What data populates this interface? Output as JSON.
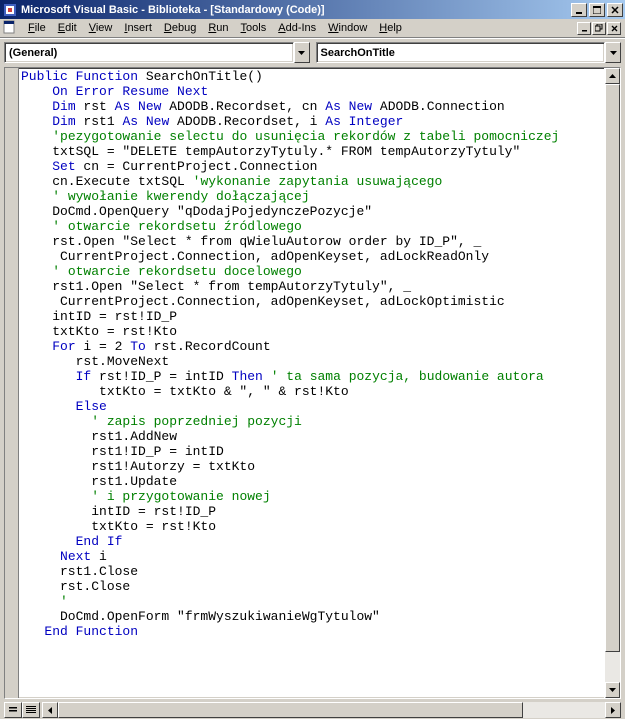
{
  "window": {
    "title": "Microsoft Visual Basic - Biblioteka - [Standardowy (Code)]"
  },
  "menu": {
    "file": "File",
    "edit": "Edit",
    "view": "View",
    "insert": "Insert",
    "debug": "Debug",
    "run": "Run",
    "tools": "Tools",
    "addins": "Add-Ins",
    "window": "Window",
    "help": "Help"
  },
  "dropdowns": {
    "object": "(General)",
    "procedure": "SearchOnTitle"
  },
  "code": {
    "l1a": "Public Function",
    "l1b": " SearchOnTitle()",
    "l2a": "    ",
    "l2b": "On Error Resume Next",
    "l3a": "    ",
    "l3b": "Dim",
    "l3c": " rst ",
    "l3d": "As New",
    "l3e": " ADODB.Recordset, cn ",
    "l3f": "As New",
    "l3g": " ADODB.Connection",
    "l4a": "    ",
    "l4b": "Dim",
    "l4c": " rst1 ",
    "l4d": "As New",
    "l4e": " ADODB.Recordset, i ",
    "l4f": "As Integer",
    "l5a": "    ",
    "l5b": "'pezygotowanie selectu do usunięcia rekordów z tabeli pomocniczej",
    "l6": "    txtSQL = \"DELETE tempAutorzyTytuly.* FROM tempAutorzyTytuly\"",
    "l7a": "    ",
    "l7b": "Set",
    "l7c": " cn = CurrentProject.Connection",
    "l8a": "    cn.Execute txtSQL ",
    "l8b": "'wykonanie zapytania usuwającego",
    "l9a": "    ",
    "l9b": "' wywołanie kwerendy dołączającej",
    "l10": "    DoCmd.OpenQuery \"qDodajPojedynczePozycje\"",
    "l11a": "    ",
    "l11b": "' otwarcie rekordsetu źródlowego",
    "l12": "    rst.Open \"Select * from qWieluAutorow order by ID_P\", _",
    "l13": "     CurrentProject.Connection, adOpenKeyset, adLockReadOnly",
    "l14a": "    ",
    "l14b": "' otwarcie rekordsetu docelowego",
    "l15": "    rst1.Open \"Select * from tempAutorzyTytuly\", _",
    "l16": "     CurrentProject.Connection, adOpenKeyset, adLockOptimistic",
    "l17": "    intID = rst!ID_P",
    "l18": "    txtKto = rst!Kto",
    "l19a": "    ",
    "l19b": "For",
    "l19c": " i = 2 ",
    "l19d": "To",
    "l19e": " rst.RecordCount",
    "l20": "       rst.MoveNext",
    "l21a": "       ",
    "l21b": "If",
    "l21c": " rst!ID_P = intID ",
    "l21d": "Then",
    "l21e": " ",
    "l21f": "' ta sama pozycja, budowanie autora",
    "l22": "          txtKto = txtKto & \", \" & rst!Kto",
    "l23a": "       ",
    "l23b": "Else",
    "l24a": "         ",
    "l24b": "' zapis poprzedniej pozycji",
    "l25": "         rst1.AddNew",
    "l26": "         rst1!ID_P = intID",
    "l27": "         rst1!Autorzy = txtKto",
    "l28": "         rst1.Update",
    "l29a": "         ",
    "l29b": "' i przygotowanie nowej",
    "l30": "         intID = rst!ID_P",
    "l31": "         txtKto = rst!Kto",
    "l32a": "       ",
    "l32b": "End If",
    "l33a": "     ",
    "l33b": "Next",
    "l33c": " i",
    "l34": "     rst1.Close",
    "l35": "     rst.Close",
    "l36a": "     ",
    "l36b": "'",
    "l37": "     DoCmd.OpenForm \"frmWyszukiwanieWgTytulow\"",
    "l38a": "   ",
    "l38b": "End Function"
  }
}
